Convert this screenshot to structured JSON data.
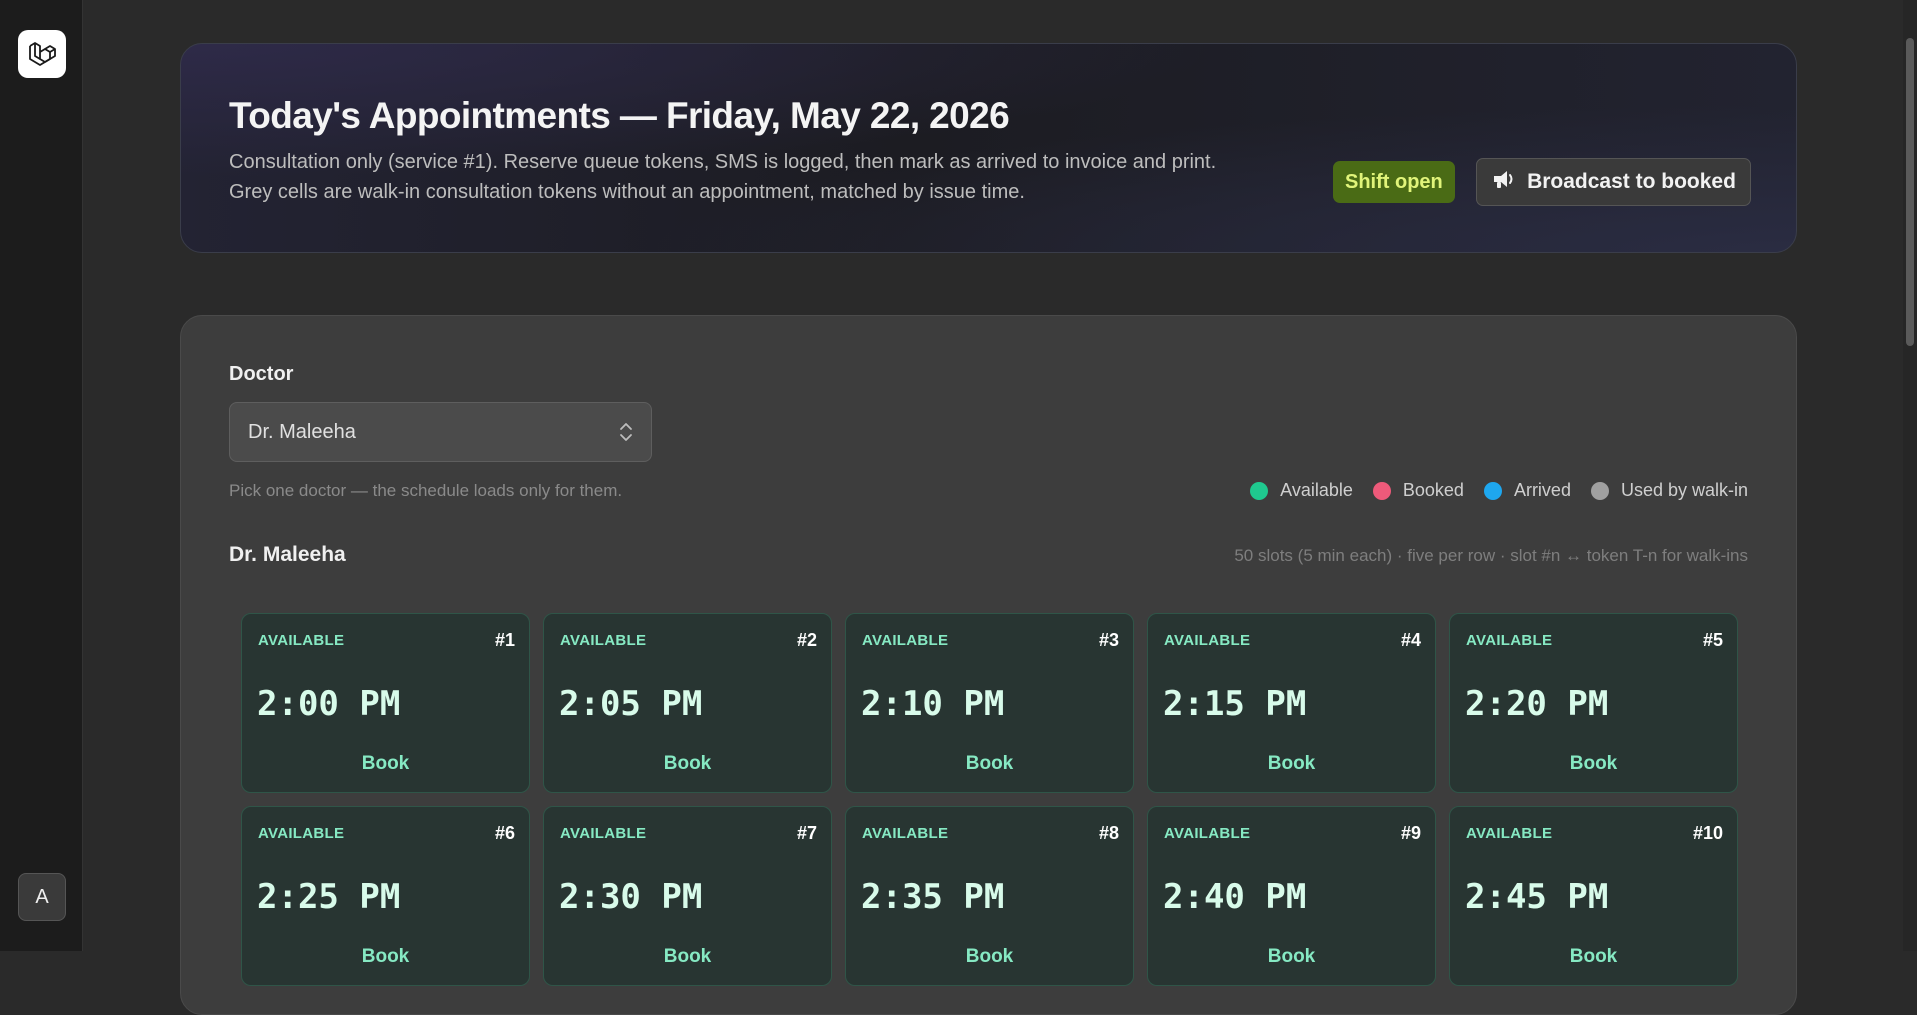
{
  "sidebar": {
    "avatar_initial": "A"
  },
  "header": {
    "title": "Today's Appointments — Friday, May 22, 2026",
    "description": "Consultation only (service #1). Reserve queue tokens, SMS is logged, then mark as arrived to invoice and print. Grey cells are walk-in consultation tokens without an appointment, matched by issue time.",
    "shift_status": "Shift open",
    "broadcast_label": "Broadcast to booked"
  },
  "filters": {
    "doctor_label": "Doctor",
    "doctor_selected": "Dr. Maleeha",
    "hint": "Pick one doctor — the schedule loads only for them."
  },
  "legend": [
    {
      "label": "Available",
      "color": "#1fc98f"
    },
    {
      "label": "Booked",
      "color": "#ee5a7a"
    },
    {
      "label": "Arrived",
      "color": "#1ea7ef"
    },
    {
      "label": "Used by walk-in",
      "color": "#a0a0a0"
    }
  ],
  "schedule": {
    "doctor_name": "Dr. Maleeha",
    "meta": "50 slots (5 min each) · five per row · slot #n ↔ token T-n for walk-ins",
    "slots": [
      {
        "status": "AVAILABLE",
        "number": "#1",
        "time": "2:00 PM",
        "action": "Book"
      },
      {
        "status": "AVAILABLE",
        "number": "#2",
        "time": "2:05 PM",
        "action": "Book"
      },
      {
        "status": "AVAILABLE",
        "number": "#3",
        "time": "2:10 PM",
        "action": "Book"
      },
      {
        "status": "AVAILABLE",
        "number": "#4",
        "time": "2:15 PM",
        "action": "Book"
      },
      {
        "status": "AVAILABLE",
        "number": "#5",
        "time": "2:20 PM",
        "action": "Book"
      },
      {
        "status": "AVAILABLE",
        "number": "#6",
        "time": "2:25 PM",
        "action": "Book"
      },
      {
        "status": "AVAILABLE",
        "number": "#7",
        "time": "2:30 PM",
        "action": "Book"
      },
      {
        "status": "AVAILABLE",
        "number": "#8",
        "time": "2:35 PM",
        "action": "Book"
      },
      {
        "status": "AVAILABLE",
        "number": "#9",
        "time": "2:40 PM",
        "action": "Book"
      },
      {
        "status": "AVAILABLE",
        "number": "#10",
        "time": "2:45 PM",
        "action": "Book"
      }
    ]
  }
}
